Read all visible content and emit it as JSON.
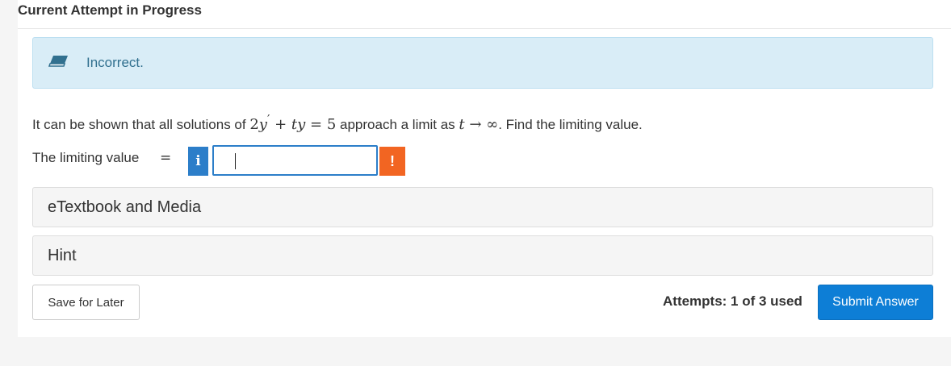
{
  "header": {
    "title": "Current Attempt in Progress"
  },
  "feedback": {
    "icon": "eraser-icon",
    "status": "Incorrect.",
    "color": "#d9edf7"
  },
  "question": {
    "prefix": "It can be shown that all solutions of ",
    "math_lhs_a": "2",
    "math_lhs_b": "y",
    "math_prime": "′",
    "math_plus": " + ",
    "math_t": "t",
    "math_y": "y",
    "math_eq": " = ",
    "math_rhs": "5",
    "middle": " approach a limit as ",
    "limit_var": "t",
    "arrow": " → ",
    "infinity": "∞",
    "suffix": ". Find the limiting value."
  },
  "answer": {
    "label": "The limiting value",
    "equals": "=",
    "info_label": "i",
    "value": "",
    "warning_label": "!"
  },
  "panels": {
    "etextbook": "eTextbook and Media",
    "hint": "Hint"
  },
  "footer": {
    "save_label": "Save for Later",
    "attempts": "Attempts: 1 of 3 used",
    "submit_label": "Submit Answer",
    "accent": "#0d7ed6"
  }
}
